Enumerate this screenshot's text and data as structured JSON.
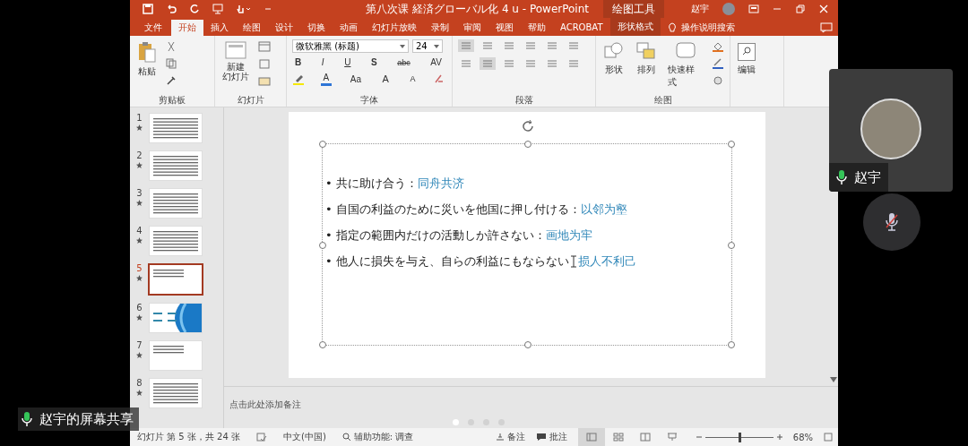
{
  "title_bar": {
    "title": "第八次课 経済グローバル化 4  u  -  PowerPoint",
    "context_label": "绘图工具",
    "user": "赵宇"
  },
  "tabs": [
    {
      "label": "文件",
      "selected": false,
      "kind": "file"
    },
    {
      "label": "开始",
      "selected": true,
      "kind": "tab"
    },
    {
      "label": "插入",
      "selected": false,
      "kind": "tab"
    },
    {
      "label": "绘图",
      "selected": false,
      "kind": "tab"
    },
    {
      "label": "设计",
      "selected": false,
      "kind": "tab"
    },
    {
      "label": "切换",
      "selected": false,
      "kind": "tab"
    },
    {
      "label": "动画",
      "selected": false,
      "kind": "tab"
    },
    {
      "label": "幻灯片放映",
      "selected": false,
      "kind": "tab"
    },
    {
      "label": "录制",
      "selected": false,
      "kind": "tab"
    },
    {
      "label": "审阅",
      "selected": false,
      "kind": "tab"
    },
    {
      "label": "视图",
      "selected": false,
      "kind": "tab"
    },
    {
      "label": "帮助",
      "selected": false,
      "kind": "tab"
    },
    {
      "label": "ACROBAT",
      "selected": false,
      "kind": "tab"
    },
    {
      "label": "形状格式",
      "selected": false,
      "kind": "context"
    }
  ],
  "tell_me": "操作说明搜索",
  "ribbon": {
    "clipboard": {
      "paste": "粘贴",
      "label": "剪贴板"
    },
    "slides": {
      "new_slide": [
        "新建",
        "幻灯片"
      ],
      "label": "幻灯片"
    },
    "font": {
      "font_name": "微软雅黑 (标题)",
      "font_size": "24",
      "label": "字体",
      "row_1": [
        {
          "kind": "bold",
          "text": "B"
        },
        {
          "kind": "italic",
          "text": "I"
        },
        {
          "kind": "underline",
          "text": "U"
        },
        {
          "kind": "shadow",
          "text": "S"
        },
        {
          "kind": "strike",
          "text": "abc"
        },
        {
          "kind": "spacing",
          "text": "AV"
        }
      ],
      "row_2": [
        {
          "kind": "highlight"
        },
        {
          "kind": "color",
          "text": "A"
        },
        {
          "kind": "case",
          "text": "Aa"
        },
        {
          "kind": "grow",
          "text": "A"
        },
        {
          "kind": "shrink",
          "text": "A"
        },
        {
          "kind": "clear"
        }
      ]
    },
    "paragraph": {
      "label": "段落"
    },
    "drawing": {
      "label": "绘图",
      "shapes": "形状",
      "arrange": "排列",
      "quick_styles": "快速样式"
    },
    "editing": {
      "label": "编辑"
    }
  },
  "thumbnails": [
    {
      "number": "1",
      "selected": false,
      "kind": "text"
    },
    {
      "number": "2",
      "selected": false,
      "kind": "text"
    },
    {
      "number": "3",
      "selected": false,
      "kind": "text"
    },
    {
      "number": "4",
      "selected": false,
      "kind": "text"
    },
    {
      "number": "5",
      "selected": true,
      "kind": "list"
    },
    {
      "number": "6",
      "selected": false,
      "kind": "design"
    },
    {
      "number": "7",
      "selected": false,
      "kind": "list"
    },
    {
      "number": "8",
      "selected": false,
      "kind": "text"
    }
  ],
  "slide": {
    "bullet": "•",
    "bullets": [
      {
        "text": "共に助け合う：",
        "idiom": "同舟共济",
        "cursor": false
      },
      {
        "text": "自国の利益のために災いを他国に押し付ける：",
        "idiom": "以邻为壑",
        "cursor": false
      },
      {
        "text": "指定の範囲内だけの活動しか許さない：",
        "idiom": "画地为牢",
        "cursor": false
      },
      {
        "text": "他人に損失を与え、自らの利益にもならない",
        "idiom": "损人不利己",
        "cursor": true
      }
    ]
  },
  "notes": {
    "placeholder": "点击此处添加备注"
  },
  "status_bar": {
    "slide_info": "幻灯片 第 5 张，共 24 张",
    "language": "中文(中国)",
    "accessibility": "辅助功能: 调查",
    "notes": "备注",
    "comments": "批注",
    "zoom": "68%",
    "zoom_level": {
      "level": 0.5
    }
  },
  "page_dots": [
    {
      "selected": true
    },
    {
      "selected": false
    },
    {
      "selected": false
    },
    {
      "selected": false
    }
  ],
  "participant": {
    "name": "赵宇",
    "mic_on": true
  },
  "mute_button": {
    "muted": true
  },
  "share_label": "赵宇的屏幕共享"
}
